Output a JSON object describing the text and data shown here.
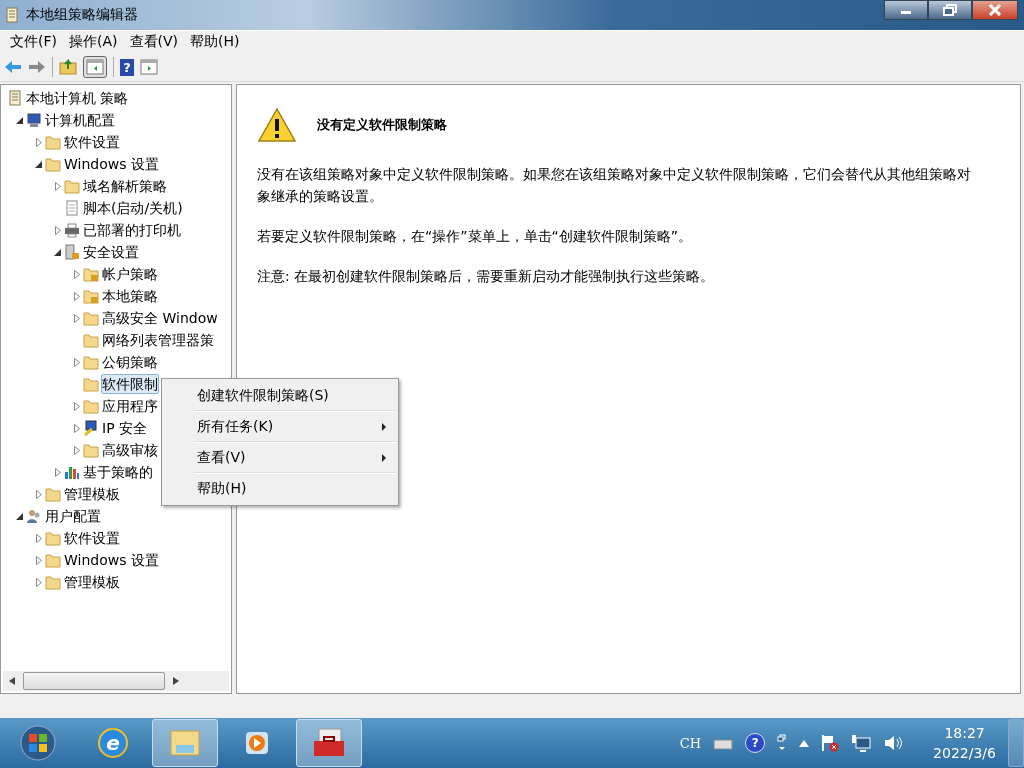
{
  "window": {
    "title": "本地组策略编辑器"
  },
  "menu_bar": [
    "文件(F)",
    "操作(A)",
    "查看(V)",
    "帮助(H)"
  ],
  "toolbar": {
    "help_glyph": "?"
  },
  "tree": [
    {
      "label": "本地计算机 策略",
      "kind": "doc",
      "selected": false,
      "children": [
        {
          "label": "计算机配置",
          "kind": "computer",
          "expanded": true,
          "selected": false,
          "children": [
            {
              "label": "软件设置",
              "kind": "folder",
              "expanded": false,
              "selected": false
            },
            {
              "label": "Windows 设置",
              "kind": "folder",
              "expanded": true,
              "selected": false,
              "children": [
                {
                  "label": "域名解析策略",
                  "kind": "folder",
                  "expanded": false,
                  "selected": false
                },
                {
                  "label": "脚本(启动/关机)",
                  "kind": "script",
                  "selected": false
                },
                {
                  "label": "已部署的打印机",
                  "kind": "printer",
                  "expanded": false,
                  "selected": false
                },
                {
                  "label": "安全设置",
                  "kind": "security",
                  "expanded": true,
                  "selected": false,
                  "children": [
                    {
                      "label": "帐户策略",
                      "kind": "folder-lock",
                      "expanded": false,
                      "selected": false
                    },
                    {
                      "label": "本地策略",
                      "kind": "folder-lock",
                      "expanded": false,
                      "selected": false
                    },
                    {
                      "label": "高级安全 Window",
                      "kind": "folder",
                      "expanded": false,
                      "selected": false
                    },
                    {
                      "label": "网络列表管理器策",
                      "kind": "folder",
                      "selected": false
                    },
                    {
                      "label": "公钥策略",
                      "kind": "folder",
                      "expanded": false,
                      "selected": false
                    },
                    {
                      "label": "软件限制",
                      "kind": "folder",
                      "selected": true
                    },
                    {
                      "label": "应用程序",
                      "kind": "folder",
                      "expanded": false,
                      "selected": false
                    },
                    {
                      "label": "IP 安全",
                      "kind": "ip",
                      "expanded": false,
                      "selected": false
                    },
                    {
                      "label": "高级审核",
                      "kind": "folder",
                      "expanded": false,
                      "selected": false
                    }
                  ]
                },
                {
                  "label": "基于策略的",
                  "kind": "chart",
                  "expanded": false,
                  "selected": false
                }
              ]
            },
            {
              "label": "管理模板",
              "kind": "folder",
              "expanded": false,
              "selected": false
            }
          ]
        },
        {
          "label": "用户配置",
          "kind": "user",
          "expanded": true,
          "selected": false,
          "children": [
            {
              "label": "软件设置",
              "kind": "folder",
              "expanded": false,
              "selected": false
            },
            {
              "label": "Windows 设置",
              "kind": "folder",
              "expanded": false,
              "selected": false
            },
            {
              "label": "管理模板",
              "kind": "folder",
              "expanded": false,
              "selected": false
            }
          ]
        }
      ]
    }
  ],
  "content": {
    "heading": "没有定义软件限制策略",
    "paragraphs": [
      "没有在该组策略对象中定义软件限制策略。如果您在该组策略对象中定义软件限制策略，它们会替代从其他组策略对象继承的策略设置。",
      "若要定义软件限制策略，在“操作”菜单上，单击“创建软件限制策略”。",
      "注意: 在最初创建软件限制策略后，需要重新启动才能强制执行这些策略。"
    ]
  },
  "context_menu": [
    {
      "label": "创建软件限制策略(S)",
      "submenu": false
    },
    {
      "label": "所有任务(K)",
      "submenu": true
    },
    {
      "label": "查看(V)",
      "submenu": true
    },
    {
      "label": "帮助(H)",
      "submenu": false
    }
  ],
  "taskbar": {
    "browser_glyph": "e",
    "language": "CH",
    "help_glyph": "?",
    "time": "18:27",
    "date": "2022/3/6"
  }
}
